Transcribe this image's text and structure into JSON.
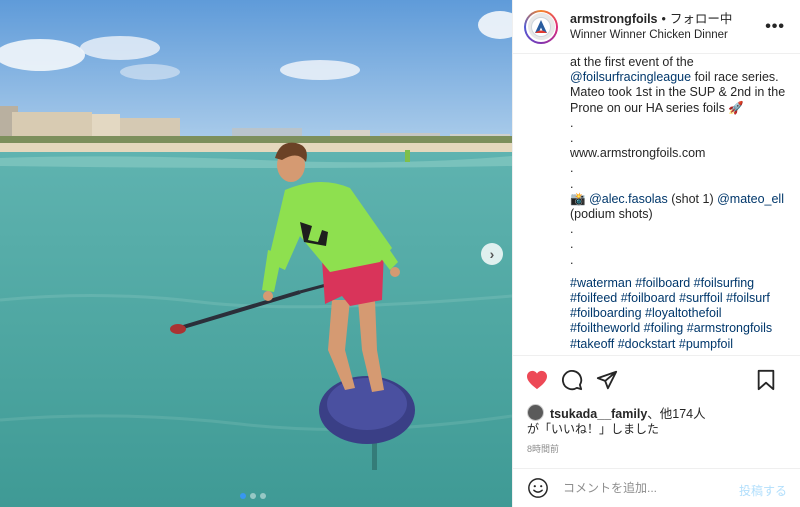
{
  "photo": {
    "carousel": {
      "dot_count": 3,
      "active_index": 0
    },
    "next_icon": "chevron-right-icon"
  },
  "header": {
    "username": "armstrongfoils",
    "separator": "•",
    "follow_status": "フォロー中",
    "subtitle": "Winner Winner Chicken Dinner",
    "avatar_icon": "brand-logo-icon",
    "more_icon": "more-horizontal-icon"
  },
  "caption": {
    "line1": "at the first event of the",
    "line2_link": "@foilsurfracingleague",
    "line2_text": " foil race series.",
    "line3": "Mateo took 1st in the SUP & 2nd in the",
    "line4_text": "Prone on our HA series foils ",
    "line4_emoji": "🚀",
    "dot1": ".",
    "dot2": ".",
    "website": "www.armstrongfoils.com",
    "dot3": ".",
    "dot4": ".",
    "camera_emoji": "📸",
    "credit_link1": "@alec.fasolas",
    "credit_text1": " (shot 1) ",
    "credit_link2": "@mateo_ell",
    "credit_line2": "(podium shots)",
    "dot5": ".",
    "dot6": ".",
    "dot7": ".",
    "hashtags_line1": "#waterman #foilboard #foilsurfing",
    "hashtags_line2": "#foilfeed #foilboard #surffoil #foilsurf",
    "hashtags_line3": "#foilboarding #loyaltothefoil",
    "hashtags_line4": "#foiltheworld #foiling #armstrongfoils",
    "hashtags_line5": "#takeoff #dockstart #pumpfoil"
  },
  "actions": {
    "like_icon": "heart-filled-icon",
    "comment_icon": "comment-icon",
    "share_icon": "share-icon",
    "save_icon": "bookmark-icon",
    "like_color": "#ed4956"
  },
  "likes": {
    "user": "tsukada__family",
    "others": "、他174人",
    "line2": "が「いいね！」しました"
  },
  "time": "8時間前",
  "comment": {
    "emoji_icon": "smiley-icon",
    "placeholder": "コメントを追加...",
    "post_label": "投稿する"
  },
  "colors": {
    "link": "#00376b",
    "accent": "#3897f0",
    "muted": "#8e8e8e"
  }
}
